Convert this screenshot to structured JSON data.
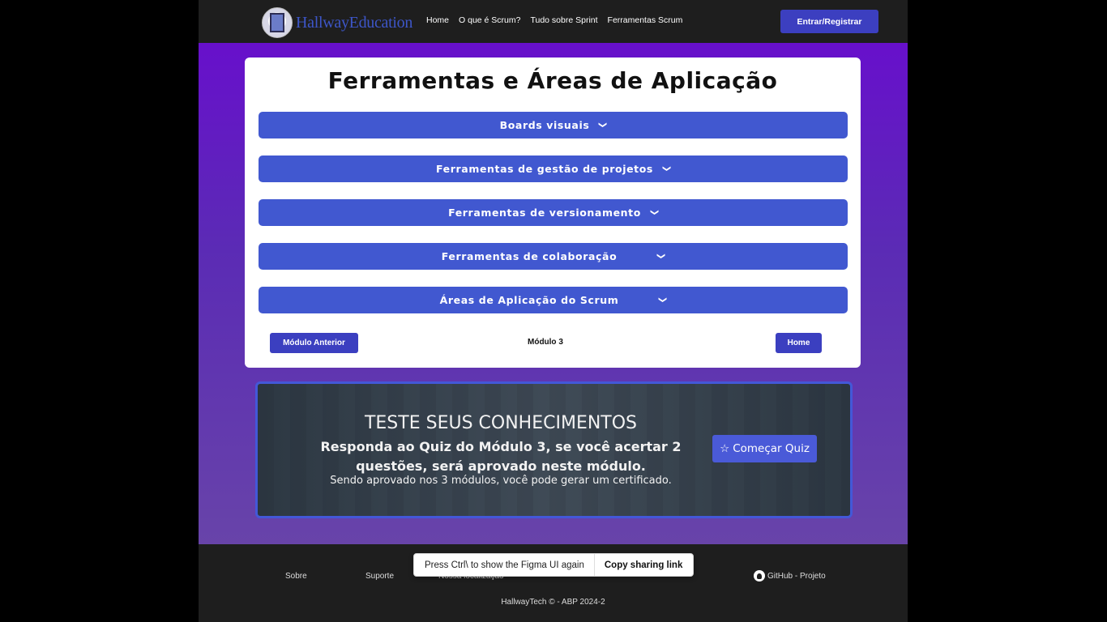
{
  "header": {
    "logo_text": "HallwayEducation",
    "nav": [
      "Home",
      "O que é Scrum?",
      "Tudo sobre Sprint",
      "Ferramentas Scrum"
    ],
    "login_label": "Entrar/Registrar"
  },
  "card": {
    "title": "Ferramentas e Áreas de Aplicação",
    "accordions": [
      "Boards visuais",
      "Ferramentas de gestão de projetos",
      "Ferramentas de versionamento",
      "Ferramentas de colaboração",
      "Áreas de Aplicação do Scrum"
    ],
    "chevron": "❯",
    "prev_label": "Módulo Anterior",
    "module_label": "Módulo 3",
    "home_label": "Home"
  },
  "quiz": {
    "title": "TESTE SEUS CONHECIMENTOS",
    "subtitle": "Responda ao Quiz do Módulo 3, se você acertar 2 questões, será aprovado neste módulo.",
    "note": "Sendo aprovado nos 3 módulos, você pode gerar um certificado.",
    "button_label": "Começar Quiz",
    "button_icon": "☆"
  },
  "footer": {
    "links": [
      "Sobre",
      "Suporte",
      "Nossa localização"
    ],
    "github_label": "GitHub - Projeto",
    "copyright": "HallwayTech © - ABP 2024-2"
  },
  "toast": {
    "message": "Press Ctrl\\ to show the Figma UI again",
    "action": "Copy sharing link"
  },
  "colors": {
    "accent": "#4158d0",
    "button_dark": "#3b3fc0",
    "background_top": "#6a0ad0",
    "bar": "#1e1e1e"
  }
}
